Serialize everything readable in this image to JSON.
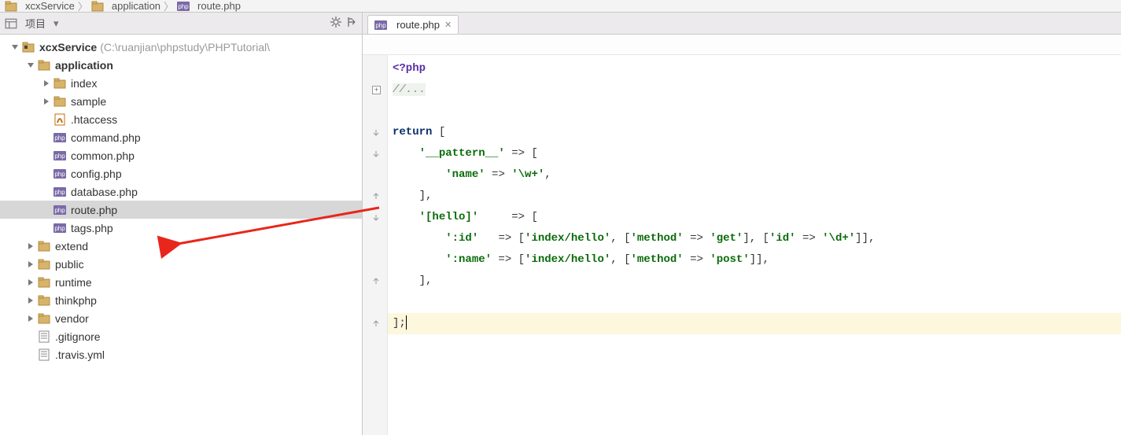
{
  "breadcrumb": [
    {
      "icon": "folder",
      "label": "xcxService"
    },
    {
      "icon": "folder",
      "label": "application"
    },
    {
      "icon": "php",
      "label": "route.php"
    }
  ],
  "left_header": {
    "title": "项目"
  },
  "tree": [
    {
      "d": 0,
      "tw": "down",
      "icon": "folder",
      "label": "xcxService",
      "bold": true,
      "path": "(C:\\ruanjian\\phpstudy\\PHPTutorial\\"
    },
    {
      "d": 1,
      "tw": "down",
      "icon": "folder",
      "label": "application",
      "bold": true
    },
    {
      "d": 2,
      "tw": "right",
      "icon": "folder",
      "label": "index"
    },
    {
      "d": 2,
      "tw": "right",
      "icon": "folder",
      "label": "sample"
    },
    {
      "d": 2,
      "tw": "",
      "icon": "htaccess",
      "label": ".htaccess"
    },
    {
      "d": 2,
      "tw": "",
      "icon": "php",
      "label": "command.php"
    },
    {
      "d": 2,
      "tw": "",
      "icon": "php",
      "label": "common.php"
    },
    {
      "d": 2,
      "tw": "",
      "icon": "php",
      "label": "config.php"
    },
    {
      "d": 2,
      "tw": "",
      "icon": "php",
      "label": "database.php"
    },
    {
      "d": 2,
      "tw": "",
      "icon": "php",
      "label": "route.php",
      "sel": true
    },
    {
      "d": 2,
      "tw": "",
      "icon": "php",
      "label": "tags.php"
    },
    {
      "d": 1,
      "tw": "right",
      "icon": "folder",
      "label": "extend"
    },
    {
      "d": 1,
      "tw": "right",
      "icon": "folder",
      "label": "public"
    },
    {
      "d": 1,
      "tw": "right",
      "icon": "folder",
      "label": "runtime"
    },
    {
      "d": 1,
      "tw": "right",
      "icon": "folder",
      "label": "thinkphp"
    },
    {
      "d": 1,
      "tw": "right",
      "icon": "folder",
      "label": "vendor"
    },
    {
      "d": 1,
      "tw": "",
      "icon": "text",
      "label": ".gitignore"
    },
    {
      "d": 1,
      "tw": "",
      "icon": "text",
      "label": ".travis.yml"
    }
  ],
  "tab": {
    "icon": "php",
    "label": "route.php"
  },
  "code_lines": [
    {
      "seg": [
        {
          "c": "hl-purple",
          "t": "<?php"
        }
      ]
    },
    {
      "fold": "plus",
      "seg": [
        {
          "c": "hl-gray",
          "t": "//..."
        }
      ]
    },
    {
      "seg": [
        {
          "t": ""
        }
      ]
    },
    {
      "fold": "minus",
      "seg": [
        {
          "c": "hl-kw",
          "t": "return"
        },
        {
          "t": " ["
        }
      ]
    },
    {
      "fold": "minus",
      "seg": [
        {
          "t": "    "
        },
        {
          "c": "str",
          "t": "'__pattern__'"
        },
        {
          "t": " => ["
        }
      ]
    },
    {
      "seg": [
        {
          "t": "        "
        },
        {
          "c": "str",
          "t": "'name'"
        },
        {
          "t": " => "
        },
        {
          "c": "str",
          "t": "'\\w+'"
        },
        {
          "t": ","
        }
      ]
    },
    {
      "fold": "up",
      "seg": [
        {
          "t": "    ],"
        }
      ]
    },
    {
      "fold": "minus",
      "seg": [
        {
          "t": "    "
        },
        {
          "c": "str",
          "t": "'[hello]'"
        },
        {
          "t": "     => ["
        }
      ]
    },
    {
      "seg": [
        {
          "t": "        "
        },
        {
          "c": "str",
          "t": "':id'"
        },
        {
          "t": "   => ["
        },
        {
          "c": "str",
          "t": "'index/hello'"
        },
        {
          "t": ", ["
        },
        {
          "c": "str",
          "t": "'method'"
        },
        {
          "t": " => "
        },
        {
          "c": "str",
          "t": "'get'"
        },
        {
          "t": "], ["
        },
        {
          "c": "str",
          "t": "'id'"
        },
        {
          "t": " => "
        },
        {
          "c": "str",
          "t": "'\\d+'"
        },
        {
          "t": "]],"
        }
      ]
    },
    {
      "seg": [
        {
          "t": "        "
        },
        {
          "c": "str",
          "t": "':name'"
        },
        {
          "t": " => ["
        },
        {
          "c": "str",
          "t": "'index/hello'"
        },
        {
          "t": ", ["
        },
        {
          "c": "str",
          "t": "'method'"
        },
        {
          "t": " => "
        },
        {
          "c": "str",
          "t": "'post'"
        },
        {
          "t": "]],"
        }
      ]
    },
    {
      "fold": "up",
      "seg": [
        {
          "t": "    ],"
        }
      ]
    },
    {
      "seg": [
        {
          "t": ""
        }
      ]
    },
    {
      "fold": "up",
      "cur": true,
      "seg": [
        {
          "t": "];"
        }
      ],
      "caret": true
    }
  ]
}
